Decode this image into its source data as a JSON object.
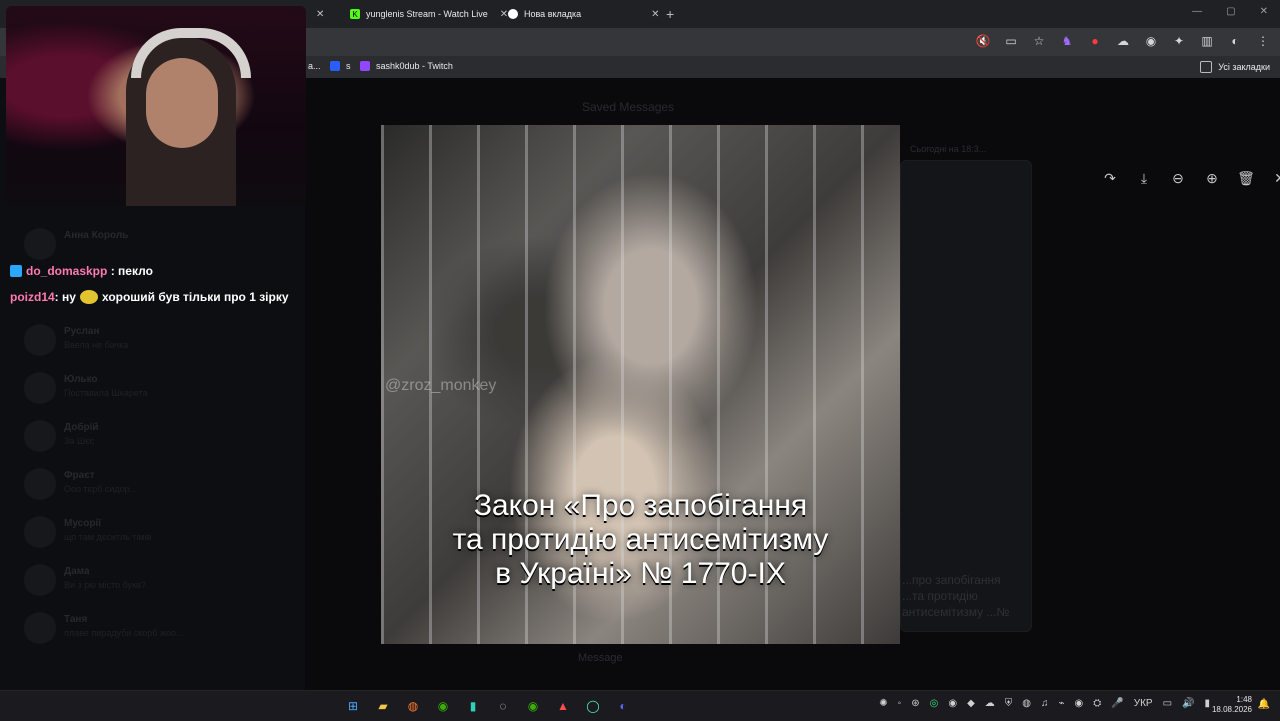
{
  "browser": {
    "tabs": [
      {
        "label": "yunglenis Stream - Watch Live",
        "icon": "kick-icon"
      },
      {
        "label": "Нова вкладка",
        "icon": "chrome-icon"
      }
    ],
    "bookmarks": [
      {
        "label": "a..."
      },
      {
        "label": "s"
      },
      {
        "label": "sashk0dub - Twitch"
      }
    ],
    "bookmarks_right": "Усі закладки",
    "accent_color": "#6bd0ff"
  },
  "telegram": {
    "header": "Saved Messages",
    "date": "Сьогодні на 18:3...",
    "message_placeholder": "Message",
    "chat_list": [
      {
        "name": "Анна Король",
        "preview": ""
      },
      {
        "name": "Руслан",
        "preview": "Ввела не бачка"
      },
      {
        "name": "Юлько",
        "preview": "Поставила Шкарета"
      },
      {
        "name": "Добрій",
        "preview": "За Шєс"
      },
      {
        "name": "Фраєт",
        "preview": "Ооо тєрб сидор..."
      },
      {
        "name": "Мусорії",
        "preview": "що там дєситль тімів"
      },
      {
        "name": "Дама",
        "preview": "Ви з рю місто букв?"
      },
      {
        "name": "Таня",
        "preview": "плаве пирадуби скорб жоо..."
      }
    ],
    "caption_faint": "...про запобігання ...та протидію антисемітизму ...№ 1770"
  },
  "viewer": {
    "controls": [
      "share-icon",
      "download-icon",
      "zoom-out-icon",
      "zoom-in-icon",
      "delete-icon",
      "close-icon"
    ],
    "watermark": "@zroz_monkey",
    "caption_lines": [
      "Закон «Про запобігання",
      "та протидію антисемітизму",
      "в Україні» № 1770-IX"
    ]
  },
  "stream_chat": [
    {
      "user": "do_domaskpp",
      "text": ": пекло"
    },
    {
      "user": "poizd14",
      "text_before": ": ну",
      "text_after": "хороший був тільки про 1 зірку"
    }
  ],
  "taskbar": {
    "language": "УКР",
    "time": "1:48",
    "date": "18.08.2026"
  }
}
